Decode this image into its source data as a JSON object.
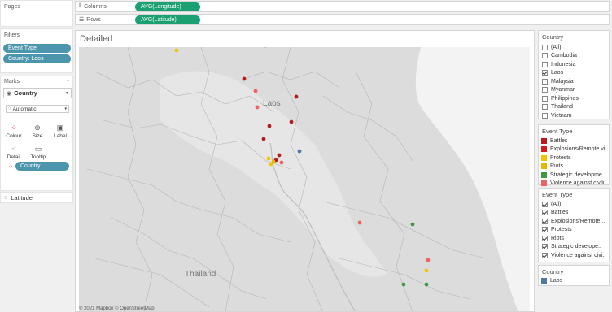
{
  "pages": {
    "label": "Pages"
  },
  "columns": {
    "label": "Columns",
    "pill": "AVG(Longitude)"
  },
  "rows": {
    "label": "Rows",
    "pill": "AVG(Latitude)"
  },
  "filters": {
    "label": "Filters",
    "items": [
      "Event Type",
      "Country: Laos"
    ]
  },
  "marks": {
    "label": "Marks",
    "layer": "Country",
    "mark_type": "Automatic",
    "buttons": [
      "Colour",
      "Size",
      "Label",
      "Detail",
      "Tooltip"
    ],
    "color_pill": "Country",
    "latitude": "Latitude"
  },
  "view": {
    "title": "Detailed",
    "map_label_country": "Laos",
    "map_label_neighbor": "Thailand",
    "attribution": "© 2021 Mapbox © OpenStreetMap"
  },
  "country_filter": {
    "title": "Country",
    "items": [
      {
        "label": "(All)",
        "checked": false
      },
      {
        "label": "Cambodia",
        "checked": false
      },
      {
        "label": "Indonesia",
        "checked": false
      },
      {
        "label": "Laos",
        "checked": true
      },
      {
        "label": "Malaysia",
        "checked": false
      },
      {
        "label": "Myanmar",
        "checked": false
      },
      {
        "label": "Philippines",
        "checked": false
      },
      {
        "label": "Thailand",
        "checked": false
      },
      {
        "label": "Vietnam",
        "checked": false
      }
    ]
  },
  "event_legend": {
    "title": "Event Type",
    "items": [
      {
        "label": "Battles",
        "color": "#b71c1c"
      },
      {
        "label": "Explosions/Remote vi..",
        "color": "#d7191c"
      },
      {
        "label": "Protests",
        "color": "#f2c500"
      },
      {
        "label": "Riots",
        "color": "#e6b800"
      },
      {
        "label": "Strategic developme..",
        "color": "#3f9a3f"
      },
      {
        "label": "Violence against civili..",
        "color": "#f06262"
      }
    ]
  },
  "event_filter": {
    "title": "Event Type",
    "items": [
      {
        "label": "(All)",
        "checked": true
      },
      {
        "label": "Battles",
        "checked": true
      },
      {
        "label": "Explosions/Remote ..",
        "checked": true
      },
      {
        "label": "Protests",
        "checked": true
      },
      {
        "label": "Riots",
        "checked": true
      },
      {
        "label": "Strategic develope..",
        "checked": true
      },
      {
        "label": "Violence against civi..",
        "checked": true
      }
    ]
  },
  "country_legend": {
    "title": "Country",
    "items": [
      {
        "label": "Laos",
        "color": "#4e79a7"
      }
    ]
  },
  "colors": {
    "shelf_pill": "#1aa071",
    "filter_pill": "#4c96ad"
  },
  "map_points": [
    {
      "event": "Protests",
      "color": "#f2c500"
    },
    {
      "event": "Strategic developments",
      "color": "#3f9a3f"
    },
    {
      "event": "Battles",
      "color": "#b71c1c"
    },
    {
      "event": "Violence against civilians",
      "color": "#f06262"
    },
    {
      "event": "Violence against civilians",
      "color": "#f06262"
    },
    {
      "event": "Battles",
      "color": "#b71c1c"
    },
    {
      "event": "Battles",
      "color": "#b71c1c"
    },
    {
      "event": "Battles",
      "color": "#b71c1c"
    },
    {
      "event": "Battles",
      "color": "#b71c1c"
    },
    {
      "event": "Battles",
      "color": "#b71c1c"
    },
    {
      "event": "Battles",
      "color": "#b71c1c"
    },
    {
      "event": "Protests",
      "color": "#f2c500"
    },
    {
      "event": "Protests",
      "color": "#f2c500"
    },
    {
      "event": "Riots",
      "color": "#e6b800"
    },
    {
      "event": "Violence against civilians",
      "color": "#f06262"
    },
    {
      "event": "Country",
      "color": "#4e79a7"
    },
    {
      "event": "Violence against civilians",
      "color": "#f06262"
    },
    {
      "event": "Strategic developments",
      "color": "#3f9a3f"
    },
    {
      "event": "Violence against civilians",
      "color": "#f06262"
    },
    {
      "event": "Protests",
      "color": "#f2c500"
    },
    {
      "event": "Strategic developments",
      "color": "#3f9a3f"
    },
    {
      "event": "Strategic developments",
      "color": "#3f9a3f"
    }
  ]
}
